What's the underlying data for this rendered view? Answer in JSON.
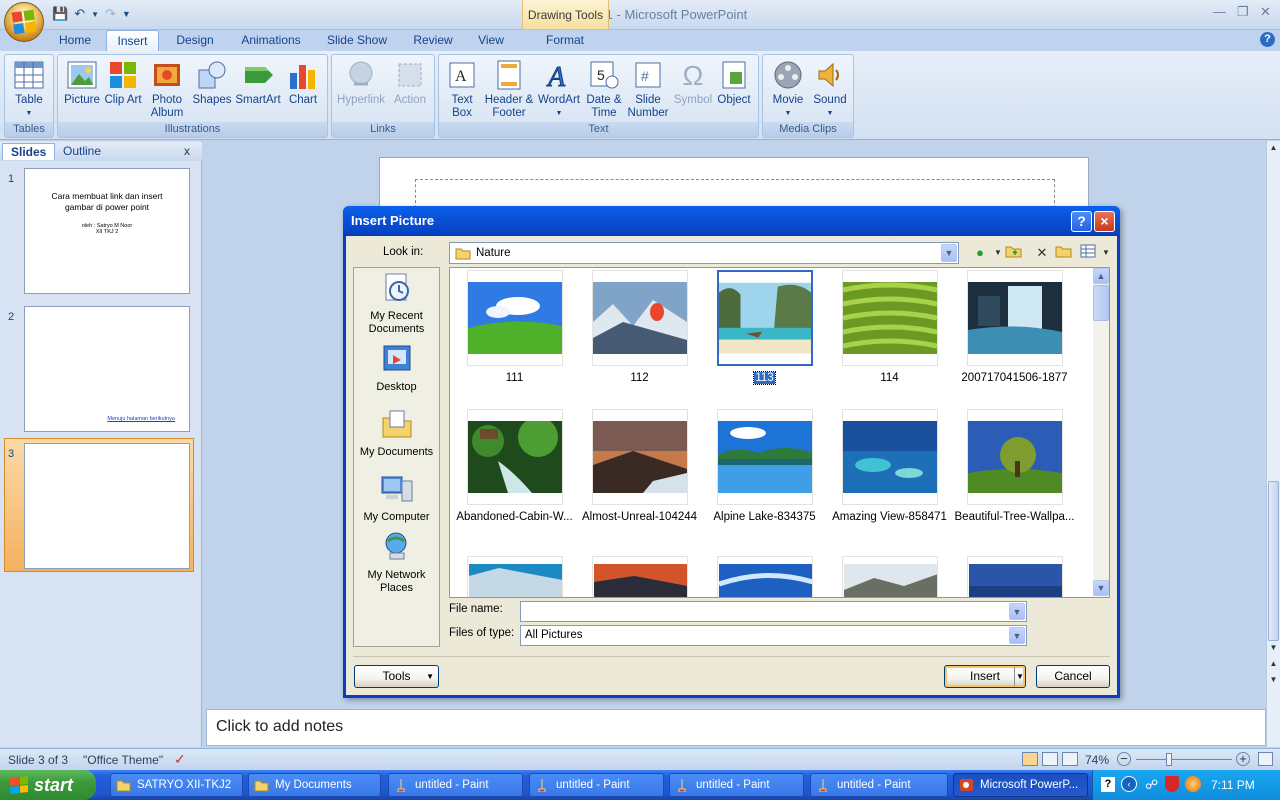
{
  "window": {
    "title": "Presentation1 - Microsoft PowerPoint",
    "contextual_tab_group": "Drawing Tools"
  },
  "tabs": [
    "Home",
    "Insert",
    "Design",
    "Animations",
    "Slide Show",
    "Review",
    "View",
    "Format"
  ],
  "active_tab": "Insert",
  "ribbon": {
    "groups": [
      "Tables",
      "Illustrations",
      "Links",
      "Text",
      "Media Clips"
    ],
    "buttons": {
      "table": "Table",
      "picture": "Picture",
      "clip_art": "Clip Art",
      "photo_album": "Photo Album",
      "shapes": "Shapes",
      "smartart": "SmartArt",
      "chart": "Chart",
      "hyperlink": "Hyperlink",
      "action": "Action",
      "text_box": "Text Box",
      "header_footer": "Header & Footer",
      "wordart": "WordArt",
      "date_time": "Date & Time",
      "slide_number": "Slide Number",
      "symbol": "Symbol",
      "object": "Object",
      "movie": "Movie",
      "sound": "Sound"
    }
  },
  "left_pane": {
    "tabs": [
      "Slides",
      "Outline"
    ],
    "close_glyph": "x",
    "slides": [
      {
        "num": "1",
        "title": "Cara membuat link dan insert gambar di power point",
        "sub1": "oleh : Satryo M Noor",
        "sub2": "XII TKJ 2"
      },
      {
        "num": "2",
        "link": "Menuju halaman berikutnya"
      },
      {
        "num": "3"
      }
    ]
  },
  "notes_placeholder": "Click to add notes",
  "status": {
    "slide": "Slide 3 of 3",
    "theme": "\"Office Theme\"",
    "zoom": "74%"
  },
  "dialog": {
    "title": "Insert Picture",
    "help": "?",
    "close": "×",
    "look_in_label": "Look in:",
    "look_in_value": "Nature",
    "places": [
      "My Recent Documents",
      "Desktop",
      "My Documents",
      "My Computer",
      "My Network Places"
    ],
    "files": [
      "111",
      "112",
      "113",
      "114",
      "200717041506-1877",
      "Abandoned-Cabin-W...",
      "Almost-Unreal-104244",
      "Alpine Lake-834375",
      "Amazing View-858471",
      "Beautiful-Tree-Wallpa..."
    ],
    "selected_file": "113",
    "file_name_label": "File name:",
    "file_name_value": "",
    "file_type_label": "Files of type:",
    "file_type_value": "All Pictures",
    "tools_button": "Tools",
    "insert_button": "Insert",
    "cancel_button": "Cancel"
  },
  "taskbar": {
    "start": "start",
    "items": [
      "SATRYO XII-TKJ2",
      "My Documents",
      "untitled - Paint",
      "untitled - Paint",
      "untitled - Paint",
      "untitled - Paint",
      "Microsoft PowerP..."
    ],
    "clock": "7:11 PM"
  },
  "colors": {
    "accent": "#316ac5",
    "dialog_title": "#0a52d9",
    "taskbar": "#245edb",
    "ribbon": "#dbe6f4"
  }
}
